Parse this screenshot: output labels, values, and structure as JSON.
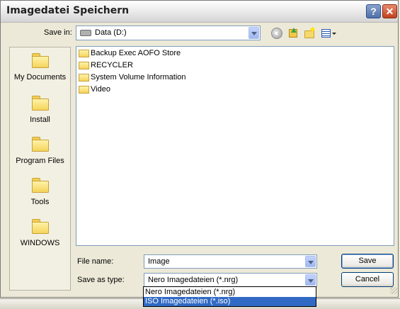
{
  "window": {
    "title": "Imagedatei Speichern"
  },
  "titlebar": {
    "help": "?",
    "close": "✕"
  },
  "save_in": {
    "label": "Save in:",
    "value": "Data (D:)"
  },
  "places": [
    {
      "label": "My Documents"
    },
    {
      "label": "Install"
    },
    {
      "label": "Program Files"
    },
    {
      "label": "Tools"
    },
    {
      "label": "WINDOWS"
    }
  ],
  "files": [
    {
      "name": "Backup Exec AOFO Store"
    },
    {
      "name": "RECYCLER"
    },
    {
      "name": "System Volume Information"
    },
    {
      "name": "Video"
    }
  ],
  "file_name": {
    "label": "File name:",
    "value": "Image"
  },
  "save_as_type": {
    "label": "Save as type:",
    "value": "Nero Imagedateien (*.nrg)",
    "options": [
      "Nero Imagedateien (*.nrg)",
      "ISO Imagedateien (*.iso)"
    ],
    "selected_index": 1
  },
  "buttons": {
    "save": "Save",
    "cancel": "Cancel"
  }
}
